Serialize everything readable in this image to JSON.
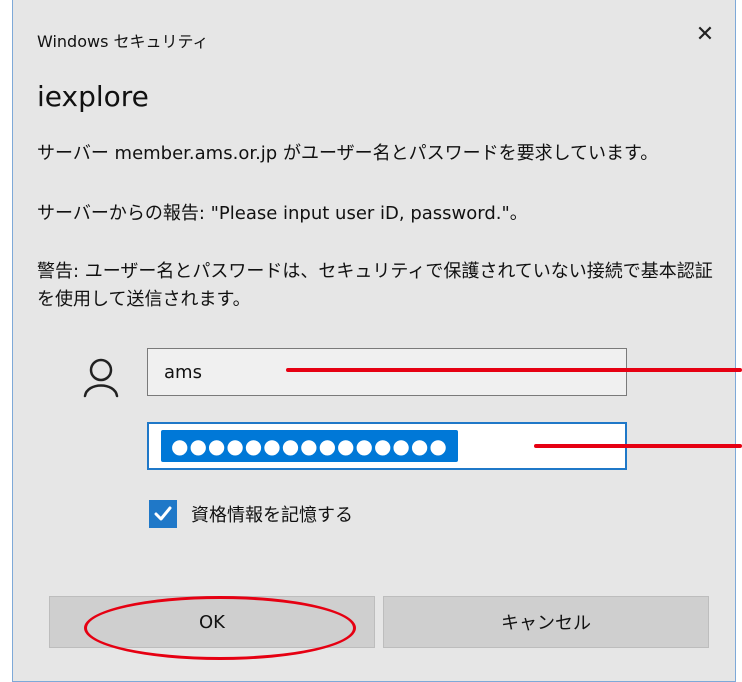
{
  "window": {
    "header": "Windows セキュリティ",
    "close_icon": "close-icon"
  },
  "dialog": {
    "app_title": "iexplore",
    "message_server": "サーバー member.ams.or.jp がユーザー名とパスワードを要求しています。",
    "message_report": "サーバーからの報告: \"Please input user iD, password.\"。",
    "warning": "警告: ユーザー名とパスワードは、セキュリティで保護されていない接続で基本認証を使用して送信されます。"
  },
  "form": {
    "user_icon": "person-icon",
    "username_value": "ams",
    "password_masked": "●●●●●●●●●●●●●●●",
    "remember_label": "資格情報を記憶する",
    "remember_checked": true
  },
  "buttons": {
    "ok_label": "OK",
    "cancel_label": "キャンセル"
  },
  "annotations": {
    "accent_color": "#e60012"
  }
}
